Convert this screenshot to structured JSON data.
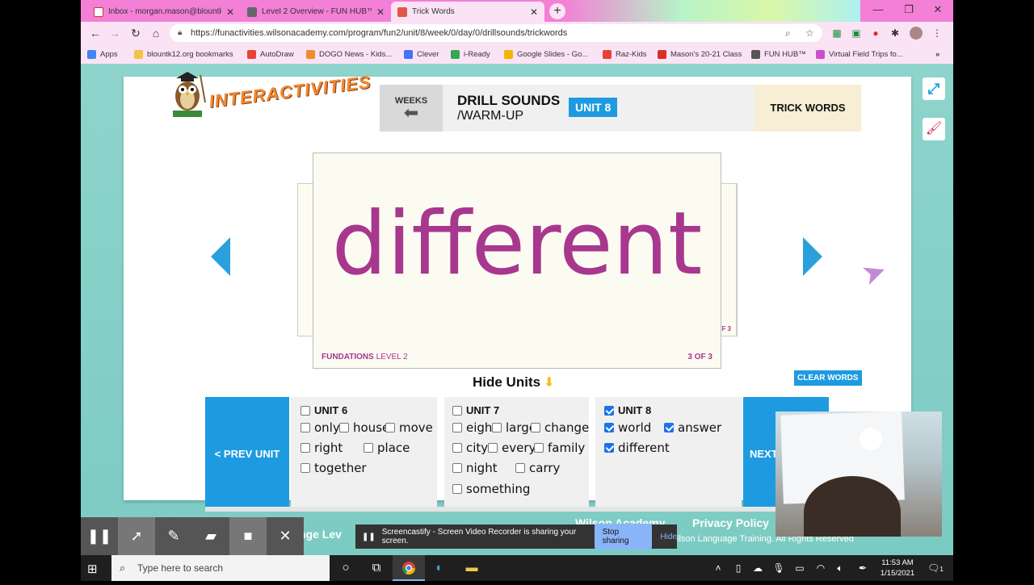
{
  "browser": {
    "tabs": [
      {
        "title": "Inbox - morgan.mason@blountk",
        "icon_color": "#ffffff"
      },
      {
        "title": "Level 2 Overview - FUN HUB™",
        "icon_color": "#666666"
      },
      {
        "title": "Trick Words",
        "icon_color": "#e0574a"
      }
    ],
    "url": "https://funactivities.wilsonacademy.com/program/fun2/unit/8/week/0/day/0/drillsounds/trickwords",
    "bookmarks": [
      {
        "label": "Apps",
        "icon_color": "#4285f4"
      },
      {
        "label": "blountk12.org bookmarks",
        "icon_color": "#f5c242"
      },
      {
        "label": "AutoDraw",
        "icon_color": "#e94235"
      },
      {
        "label": "DOGO News - Kids...",
        "icon_color": "#f28b30"
      },
      {
        "label": "Clever",
        "icon_color": "#4274f4"
      },
      {
        "label": "i-Ready",
        "icon_color": "#34a853"
      },
      {
        "label": "Google Slides - Go...",
        "icon_color": "#f5b400"
      },
      {
        "label": "Raz-Kids",
        "icon_color": "#e94235"
      },
      {
        "label": "Mason's 20-21 Class",
        "icon_color": "#d93025"
      },
      {
        "label": "FUN HUB™",
        "icon_color": "#555555"
      },
      {
        "label": "Virtual Field Trips fo...",
        "icon_color": "#c94fcf"
      }
    ]
  },
  "app": {
    "logo_text": "INTERACTIVITIES",
    "weeks_label": "WEEKS",
    "drill_title": "DRILL SOUNDS",
    "drill_sub": "/WARM-UP",
    "unit_badge": "UNIT 8",
    "trick_words": "TRICK WORDS",
    "card": {
      "word": "different",
      "brand": "FUNDATIONS",
      "level": "LEVEL 2",
      "count": "3 OF 3",
      "back_left": "FU",
      "back_right": "F 3"
    },
    "hide_units": "Hide Units",
    "clear_words": "CLEAR WORDS",
    "prev_unit": "< PREV UNIT",
    "next_unit": "NEXT",
    "units": [
      {
        "title": "UNIT 6",
        "checked": false,
        "words": [
          {
            "w": "only",
            "c": false
          },
          {
            "w": "house",
            "c": false
          },
          {
            "w": "move",
            "c": false
          },
          {
            "w": "right",
            "c": false
          },
          {
            "w": "place",
            "c": false
          },
          {
            "w": "together",
            "c": false
          }
        ]
      },
      {
        "title": "UNIT 7",
        "checked": false,
        "words": [
          {
            "w": "eight",
            "c": false
          },
          {
            "w": "large",
            "c": false
          },
          {
            "w": "change",
            "c": false
          },
          {
            "w": "city",
            "c": false
          },
          {
            "w": "every",
            "c": false
          },
          {
            "w": "family",
            "c": false
          },
          {
            "w": "night",
            "c": false
          },
          {
            "w": "carry",
            "c": false
          },
          {
            "w": "something",
            "c": false
          }
        ]
      },
      {
        "title": "UNIT 8",
        "checked": true,
        "words": [
          {
            "w": "world",
            "c": true
          },
          {
            "w": "answer",
            "c": true
          },
          {
            "w": "different",
            "c": true
          }
        ]
      }
    ],
    "footer": {
      "left": "nge Lev",
      "academy": "Wilson Academy",
      "privacy": "Privacy Policy",
      "rights": "ilson Language Training. All Rights Reserved"
    }
  },
  "screencastify": {
    "share_text": "Screencastify - Screen Video Recorder is sharing your screen.",
    "stop": "Stop sharing",
    "hide": "Hide"
  },
  "taskbar": {
    "search_placeholder": "Type here to search",
    "time": "11:53 AM",
    "date": "1/15/2021",
    "notifications": "1"
  },
  "colors": {
    "brand_purple": "#a8378e",
    "accent_blue": "#1e9be0",
    "chrome_pink": "#f37fd6"
  }
}
